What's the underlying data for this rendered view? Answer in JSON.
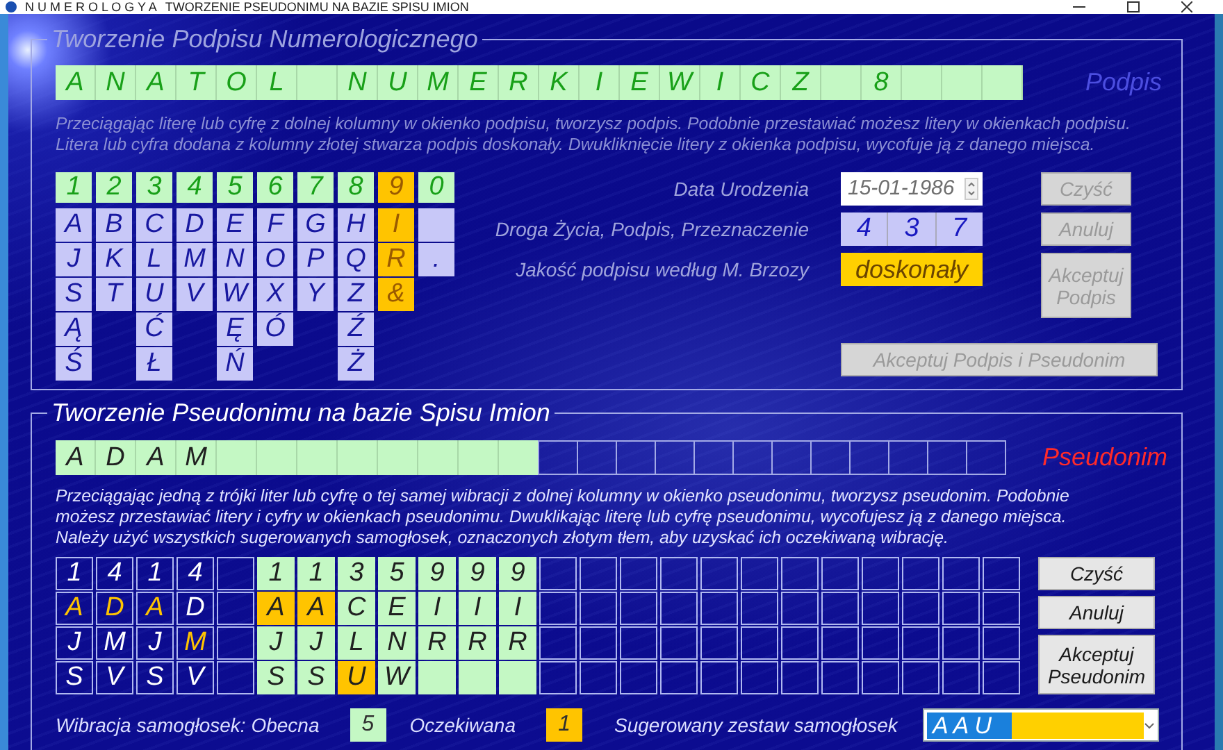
{
  "window": {
    "app_name": "N U M E R O L O G Y A",
    "title": "TWORZENIE PSEUDONIMU NA BAZIE SPISU IMION"
  },
  "signature_section": {
    "title": "Tworzenie Podpisu Numerologicznego",
    "active": false,
    "cells": [
      {
        "text": "A"
      },
      {
        "text": "N"
      },
      {
        "text": "A"
      },
      {
        "text": "T"
      },
      {
        "text": "O"
      },
      {
        "text": "L"
      },
      {},
      {
        "text": "N"
      },
      {
        "text": "U"
      },
      {
        "text": "M"
      },
      {
        "text": "E"
      },
      {
        "text": "R"
      },
      {
        "text": "K"
      },
      {
        "text": "I"
      },
      {
        "text": "E"
      },
      {
        "text": "W"
      },
      {
        "text": "I"
      },
      {
        "text": "C"
      },
      {
        "text": "Z"
      },
      {},
      {
        "text": "8"
      },
      {},
      {},
      {}
    ],
    "label": "Podpis",
    "instructions": "Przeciągając literę lub cyfrę z dolnej kolumny w okienko podpisu, tworzysz podpis. Podobnie przestawiać możesz litery w okienkach podpisu. Litera lub cyfra dodana z kolumny złotej stwarza podpis doskonały. Dwukliknięcie litery z okienka podpisu, wycofuje ją z danego miejsca.",
    "letter_columns": [
      {
        "digit": "1",
        "golden": false,
        "tiles": [
          {
            "kind": "letter",
            "text": "A"
          },
          {
            "kind": "letter",
            "text": "J"
          },
          {
            "kind": "letter",
            "text": "S"
          },
          {
            "kind": "letter",
            "text": "Ą"
          },
          {
            "kind": "letter",
            "text": "Ś"
          }
        ]
      },
      {
        "digit": "2",
        "golden": false,
        "tiles": [
          {
            "kind": "letter",
            "text": "B"
          },
          {
            "kind": "letter",
            "text": "K"
          },
          {
            "kind": "letter",
            "text": "T"
          }
        ]
      },
      {
        "digit": "3",
        "golden": false,
        "tiles": [
          {
            "kind": "letter",
            "text": "C"
          },
          {
            "kind": "letter",
            "text": "L"
          },
          {
            "kind": "letter",
            "text": "U"
          },
          {
            "kind": "letter",
            "text": "Ć"
          },
          {
            "kind": "letter",
            "text": "Ł"
          }
        ]
      },
      {
        "digit": "4",
        "golden": false,
        "tiles": [
          {
            "kind": "letter",
            "text": "D"
          },
          {
            "kind": "letter",
            "text": "M"
          },
          {
            "kind": "letter",
            "text": "V"
          }
        ]
      },
      {
        "digit": "5",
        "golden": false,
        "tiles": [
          {
            "kind": "letter",
            "text": "E"
          },
          {
            "kind": "letter",
            "text": "N"
          },
          {
            "kind": "letter",
            "text": "W"
          },
          {
            "kind": "letter",
            "text": "Ę"
          },
          {
            "kind": "letter",
            "text": "Ń"
          }
        ]
      },
      {
        "digit": "6",
        "golden": false,
        "tiles": [
          {
            "kind": "letter",
            "text": "F"
          },
          {
            "kind": "letter",
            "text": "O"
          },
          {
            "kind": "letter",
            "text": "X"
          },
          {
            "kind": "letter",
            "text": "Ó"
          }
        ]
      },
      {
        "digit": "7",
        "golden": false,
        "tiles": [
          {
            "kind": "letter",
            "text": "G"
          },
          {
            "kind": "letter",
            "text": "P"
          },
          {
            "kind": "letter",
            "text": "Y"
          }
        ]
      },
      {
        "digit": "8",
        "golden": false,
        "tiles": [
          {
            "kind": "letter",
            "text": "H"
          },
          {
            "kind": "letter",
            "text": "Q"
          },
          {
            "kind": "letter",
            "text": "Z"
          },
          {
            "kind": "letter",
            "text": "Ź"
          },
          {
            "kind": "letter",
            "text": "Ż"
          }
        ]
      },
      {
        "digit": "9",
        "golden": true,
        "tiles": [
          {
            "kind": "letter",
            "text": "I"
          },
          {
            "kind": "letter",
            "text": "R"
          },
          {
            "kind": "letter",
            "text": "&"
          }
        ]
      },
      {
        "digit": "0",
        "golden": false,
        "tiles": [
          {
            "kind": "blank"
          },
          {
            "kind": "letter",
            "text": "."
          }
        ]
      }
    ],
    "fields": [
      {
        "kind": "date",
        "label": "Data Urodzenia",
        "value": "15-01-1986"
      },
      {
        "kind": "numbers",
        "label": "Droga Życia, Podpis, Przeznaczenie",
        "values": [
          "4",
          "3",
          "7"
        ]
      },
      {
        "kind": "quality",
        "label": "Jakość podpisu według M. Brzozy",
        "value": "doskonały"
      }
    ],
    "buttons": [
      {
        "label": "Czyść",
        "disabled": true
      },
      {
        "label": "Anuluj",
        "disabled": true
      },
      {
        "label": "Akceptuj Podpis",
        "disabled": true
      }
    ],
    "accept_all_button": {
      "label": "Akceptuj Podpis i Pseudonim",
      "disabled": true
    }
  },
  "pseudonym_section": {
    "title": "Tworzenie Pseudonimu na bazie Spisu Imion",
    "active": true,
    "cells": [
      {
        "text": "A",
        "active": true
      },
      {
        "text": "D",
        "active": true
      },
      {
        "text": "A",
        "active": true
      },
      {
        "text": "M",
        "active": true
      },
      {
        "active": true
      },
      {
        "active": true
      },
      {
        "active": true
      },
      {
        "active": true
      },
      {
        "active": true
      },
      {
        "active": true
      },
      {
        "active": true
      },
      {
        "active": true
      },
      {
        "active": false
      },
      {
        "active": false
      },
      {
        "active": false
      },
      {
        "active": false
      },
      {
        "active": false
      },
      {
        "active": false
      },
      {
        "active": false
      },
      {
        "active": false
      },
      {
        "active": false
      },
      {
        "active": false
      },
      {
        "active": false
      },
      {
        "active": false
      }
    ],
    "label": "Pseudonim",
    "instructions": "Przeciągając jedną z trójki liter lub cyfrę o tej samej wibracji z dolnej kolumny w okienko pseudonimu, tworzysz pseudonim. Podobnie możesz przestawiać litery i cyfry w okienkach pseudonimu. Dwuklikając literę lub cyfrę pseudonimu, wycofujesz ją z danego miejsca. Należy użyć wszystkich sugerowanych samogłosek, oznaczonych złotym tłem, aby uzyskać ich oczekiwaną wibrację.",
    "columns": [
      {
        "kind": "name",
        "digit": "1",
        "letters": [
          {
            "text": "A",
            "marked": true
          },
          {
            "text": "J",
            "marked": false
          },
          {
            "text": "S",
            "marked": false
          }
        ]
      },
      {
        "kind": "name",
        "digit": "4",
        "letters": [
          {
            "text": "D",
            "marked": true
          },
          {
            "text": "M",
            "marked": false
          },
          {
            "text": "V",
            "marked": false
          }
        ]
      },
      {
        "kind": "name",
        "digit": "1",
        "letters": [
          {
            "text": "A",
            "marked": true
          },
          {
            "text": "J",
            "marked": false
          },
          {
            "text": "S",
            "marked": false
          }
        ]
      },
      {
        "kind": "name",
        "digit": "4",
        "letters": [
          {
            "text": "D",
            "marked": false
          },
          {
            "text": "M",
            "marked": true
          },
          {
            "text": "V",
            "marked": false
          }
        ]
      },
      {
        "kind": "empty"
      },
      {
        "kind": "candidate",
        "digit": "1",
        "letters": [
          {
            "text": "A",
            "marked": true
          },
          {
            "text": "J",
            "marked": false
          },
          {
            "text": "S",
            "marked": false
          }
        ]
      },
      {
        "kind": "candidate",
        "digit": "1",
        "letters": [
          {
            "text": "A",
            "marked": true
          },
          {
            "text": "J",
            "marked": false
          },
          {
            "text": "S",
            "marked": false
          }
        ]
      },
      {
        "kind": "candidate",
        "digit": "3",
        "letters": [
          {
            "text": "C",
            "marked": false
          },
          {
            "text": "L",
            "marked": false
          },
          {
            "text": "U",
            "marked": true
          }
        ]
      },
      {
        "kind": "candidate",
        "digit": "5",
        "letters": [
          {
            "text": "E",
            "marked": false
          },
          {
            "text": "N",
            "marked": false
          },
          {
            "text": "W",
            "marked": false
          }
        ]
      },
      {
        "kind": "candidate",
        "digit": "9",
        "letters": [
          {
            "text": "I",
            "marked": false
          },
          {
            "text": "R",
            "marked": false
          }
        ]
      },
      {
        "kind": "candidate",
        "digit": "9",
        "letters": [
          {
            "text": "I",
            "marked": false
          },
          {
            "text": "R",
            "marked": false
          }
        ]
      },
      {
        "kind": "candidate",
        "digit": "9",
        "letters": [
          {
            "text": "I",
            "marked": false
          },
          {
            "text": "R",
            "marked": false
          }
        ]
      },
      {
        "kind": "empty"
      },
      {
        "kind": "empty"
      },
      {
        "kind": "empty"
      },
      {
        "kind": "empty"
      },
      {
        "kind": "empty"
      },
      {
        "kind": "empty"
      },
      {
        "kind": "empty"
      },
      {
        "kind": "empty"
      },
      {
        "kind": "empty"
      },
      {
        "kind": "empty"
      },
      {
        "kind": "empty"
      },
      {
        "kind": "empty"
      }
    ],
    "buttons": [
      {
        "label": "Czyść",
        "disabled": false
      },
      {
        "label": "Anuluj",
        "disabled": false
      },
      {
        "label": "Akceptuj Pseudonim",
        "disabled": false
      }
    ],
    "current_vibration": {
      "label": "Wibracja samogłosek: Obecna",
      "value": "5"
    },
    "expected_vibration": {
      "label": "Oczekiwana",
      "value": "1"
    },
    "suggested_vowels": {
      "label": "Sugerowany zestaw samogłosek",
      "value": "A A U"
    }
  }
}
